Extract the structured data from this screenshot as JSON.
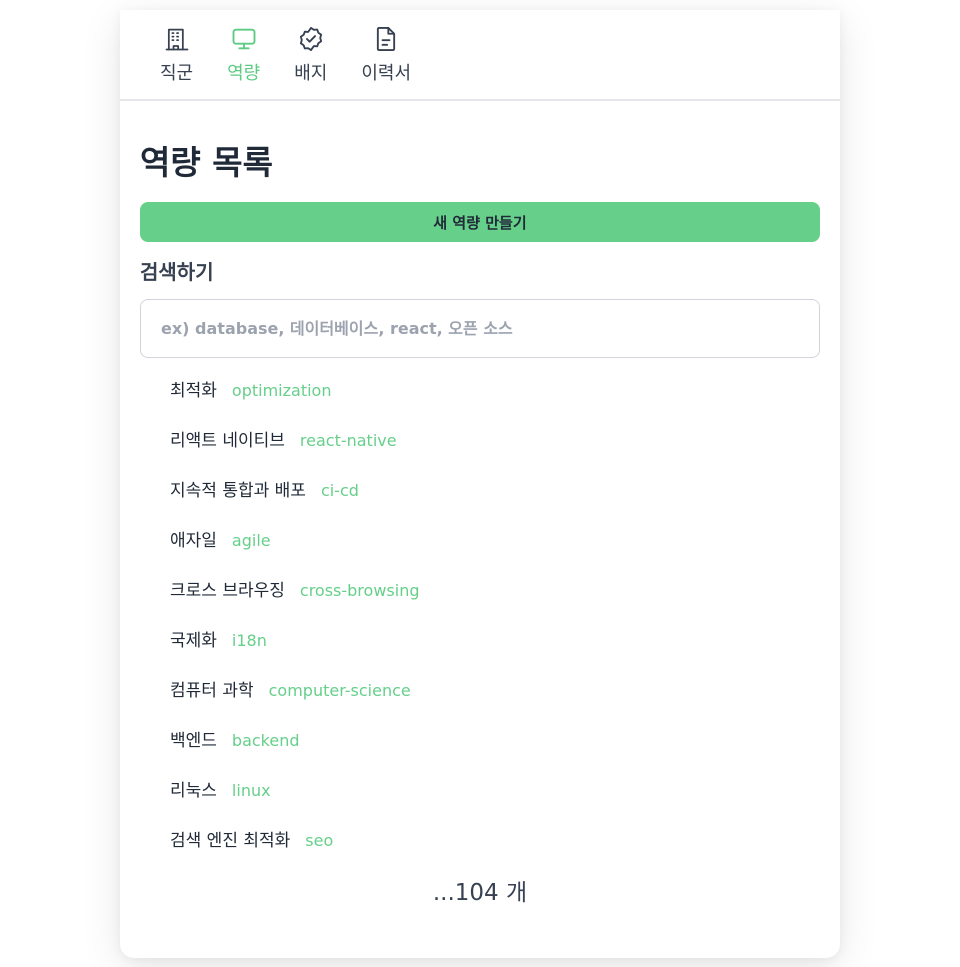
{
  "tabs": [
    {
      "label": "직군",
      "icon": "building-icon"
    },
    {
      "label": "역량",
      "icon": "monitor-icon"
    },
    {
      "label": "배지",
      "icon": "badge-check-icon"
    },
    {
      "label": "이력서",
      "icon": "document-icon"
    }
  ],
  "active_tab": "역량",
  "colors": {
    "accent": "#66cf8a",
    "text": "#1f2937"
  },
  "page": {
    "title": "역량 목록",
    "create_button_label": "새 역량 만들기",
    "search_label": "검색하기",
    "search_placeholder": "ex) database, 데이터베이스, react, 오픈 소스",
    "search_value": ""
  },
  "skills": [
    {
      "name": "최적화",
      "slug": "optimization"
    },
    {
      "name": "리액트 네이티브",
      "slug": "react-native"
    },
    {
      "name": "지속적 통합과 배포",
      "slug": "ci-cd"
    },
    {
      "name": "애자일",
      "slug": "agile"
    },
    {
      "name": "크로스 브라우징",
      "slug": "cross-browsing"
    },
    {
      "name": "국제화",
      "slug": "i18n"
    },
    {
      "name": "컴퓨터 과학",
      "slug": "computer-science"
    },
    {
      "name": "백엔드",
      "slug": "backend"
    },
    {
      "name": "리눅스",
      "slug": "linux"
    },
    {
      "name": "검색 엔진 최적화",
      "slug": "seo"
    }
  ],
  "more_text": "...104 개"
}
